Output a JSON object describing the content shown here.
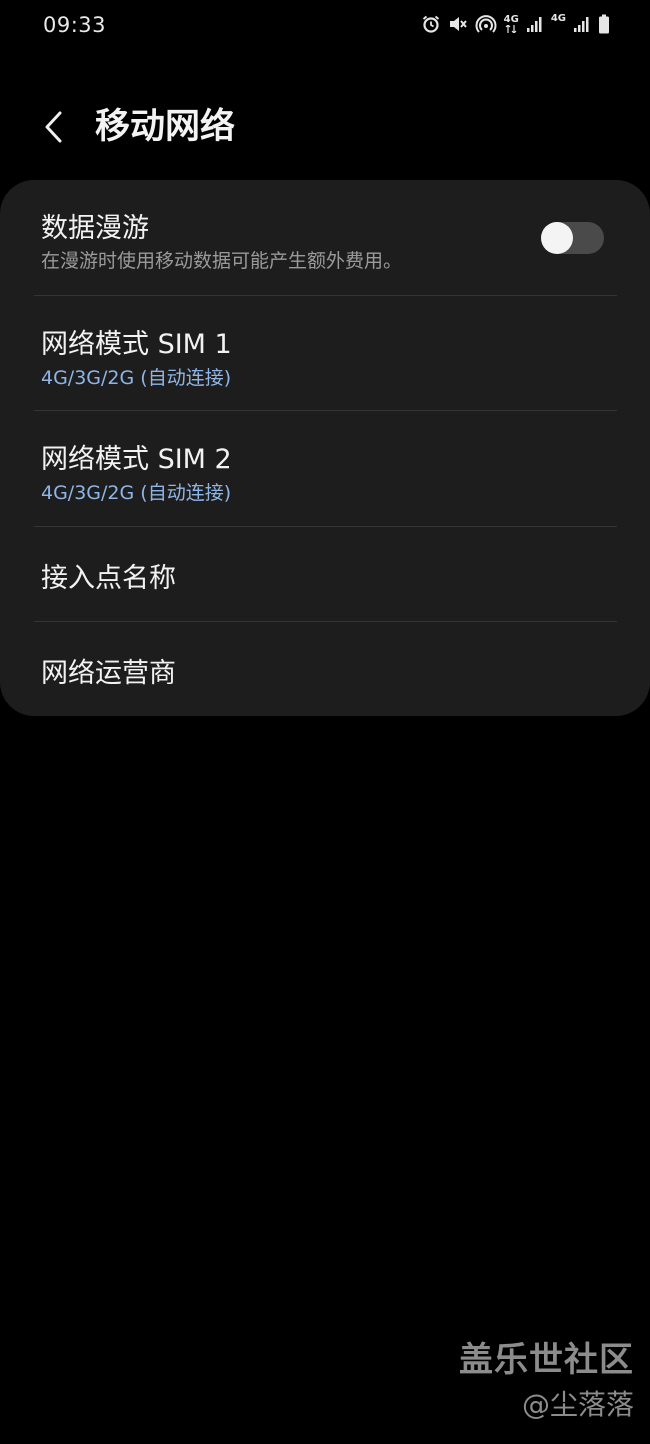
{
  "status_bar": {
    "time": "09:33",
    "network_1": "4G",
    "network_2": "4G",
    "icons": [
      "alarm-icon",
      "mute-icon",
      "hotspot-icon",
      "signal-icon",
      "signal-icon",
      "battery-icon"
    ]
  },
  "header": {
    "back_icon": "chevron-left-icon",
    "title": "移动网络"
  },
  "settings": {
    "data_roaming": {
      "title": "数据漫游",
      "subtitle": "在漫游时使用移动数据可能产生额外费用。",
      "enabled": false
    },
    "network_mode_sim1": {
      "title": "网络模式 SIM 1",
      "value": "4G/3G/2G (自动连接)"
    },
    "network_mode_sim2": {
      "title": "网络模式 SIM 2",
      "value": "4G/3G/2G (自动连接)"
    },
    "apn": {
      "title": "接入点名称"
    },
    "operators": {
      "title": "网络运营商"
    }
  },
  "watermark": {
    "brand": "盖乐世社区",
    "user": "@尘落落"
  },
  "colors": {
    "background": "#000000",
    "card": "#1d1d1d",
    "value_blue": "#8fb5e6"
  }
}
